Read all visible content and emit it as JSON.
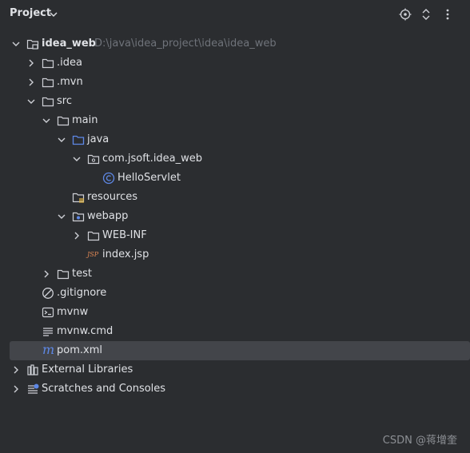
{
  "header": {
    "title": "Project"
  },
  "tree": {
    "root": {
      "name": "idea_web",
      "path": "D:\\java\\idea_project\\idea\\idea_web"
    },
    "idea_dir": "idea",
    "mvn_dir": "mvn",
    "src": "src",
    "main": "main",
    "java": "java",
    "package": "com.jsoft.idea_web",
    "servlet": "HelloServlet",
    "resources": "resources",
    "webapp": "webapp",
    "webinf": "WEB-INF",
    "indexjsp": "index.jsp",
    "test": "test",
    "gitignore": ".gitignore",
    "mvnw": "mvnw",
    "mvnwcmd": "mvnw.cmd",
    "pom": "pom.xml",
    "extlibs": "External Libraries",
    "scratches": "Scratches and Consoles"
  },
  "icons": {
    "jsp_text": "JSP",
    "pom_text": "m"
  },
  "watermark": "CSDN @蒋增奎"
}
